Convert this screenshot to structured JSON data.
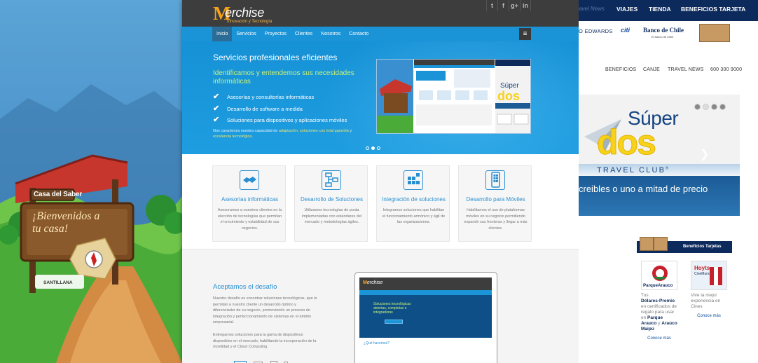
{
  "site": {
    "logo_letter": "M",
    "logo_name": "erchise",
    "logo_tagline": "Innovación y Tecnología",
    "social": [
      "t",
      "f",
      "g+",
      "in"
    ],
    "nav": [
      "Inicio",
      "Servicios",
      "Proyectos",
      "Clientes",
      "Nosotros",
      "Contacto"
    ],
    "menu_icon": "≡"
  },
  "hero": {
    "title": "Servicios profesionales eficientes",
    "subtitle": "Identificamos y entendemos sus necesidades informáticas",
    "checks": [
      "Asesorías y consultorías informáticas",
      "Desarrollo de software a medida",
      "Soluciones para dispositivos y aplicaciones móviles"
    ],
    "note_a": "Nos caracteriza nuestra capacidad de ",
    "note_hl1": "adaptación, soluciones con total garantía",
    "note_b": " y ",
    "note_hl2": "excelencia tecnológica."
  },
  "features": [
    {
      "title": "Asesorías informáticas",
      "text": "Asesoramos a nuestros clientes en la elección de tecnologías que permitan el crecimiento y estabilidad de sus negocios.",
      "icon": "handshake-icon"
    },
    {
      "title": "Desarrollo de Soluciones",
      "text": "Utilizamos tecnologías de punta implementadas con estándares del mercado y metodologías ágiles.",
      "icon": "flowchart-icon"
    },
    {
      "title": "Integración de soluciones",
      "text": "Integramos soluciones que habilitan el funcionamiento armónico y ágil de las organizaciones.",
      "icon": "puzzle-icon"
    },
    {
      "title": "Desarrollo para Móviles",
      "text": "Habilitamos el uso de plataformas móviles en su negocio permitiendo expandir sus fronteras y llegar a más clientes.",
      "icon": "mobile-icon"
    }
  ],
  "section2": {
    "title": "Aceptamos el desafío",
    "p1": "Nuestro desafío es encontrar soluciones tecnológicas, que le permitan a nuestro cliente un desarrollo óptimo y diferenciador de su negocio, promoviendo un proceso de integración y perfeccionamiento de sistemas en el ámbito empresarial.",
    "p2": "Entregamos soluciones para la gama de dispositivos disponibles en el mercado, habilitando la incorporación de la movilidad y el Cloud Computing.",
    "laptop_logo_letter": "M",
    "laptop_logo_name": "erchise",
    "laptop_headline": "Soluciones tecnológicas abiertas, completas e integradoras",
    "laptop_section": "¿Qué hacemos?"
  },
  "left_panel": {
    "sign_top": "Casa del Saber",
    "sign_main": "¡Bienvenidos a tu casa!",
    "brand": "SANTILLANA"
  },
  "right_panel": {
    "travel_news_top": "avel News",
    "top_nav": [
      "VIAJES",
      "TIENDA",
      "BENEFICIOS TARJETA"
    ],
    "brand_edwards": "O EDWARDS",
    "brand_citi": "citi",
    "brand_bch": "Banco de Chile",
    "brand_bch_sub": "El banco de Chile",
    "menu": [
      "BENEFICIOS",
      "CANJE",
      "TRAVEL NEWS",
      "600 300 9000"
    ],
    "banner_super": "Súper",
    "banner_dos": "dos",
    "banner_tc": "TRAVEL CLUB",
    "banner_line": "creibles o uno a mitad de precio",
    "benef_tarjetas": "Beneficios Tarjetas",
    "promo1_logo": "ParqueArauco",
    "promo1_text_a": "Tus",
    "promo1_text_b": "Dólares-Premio",
    "promo1_text_c": "en certificados de regalo para usar en",
    "promo1_text_d": "Parque Arauco",
    "promo1_text_e": "y",
    "promo1_text_f": "Arauco Maipú",
    "promo1_more": "Conoce más",
    "promo2_logo": "Hoyts",
    "promo2_logo_sub": "CineMundo",
    "promo2_text": "Vive la mejor experiencia en Cines",
    "promo2_more": "Conoce más"
  }
}
